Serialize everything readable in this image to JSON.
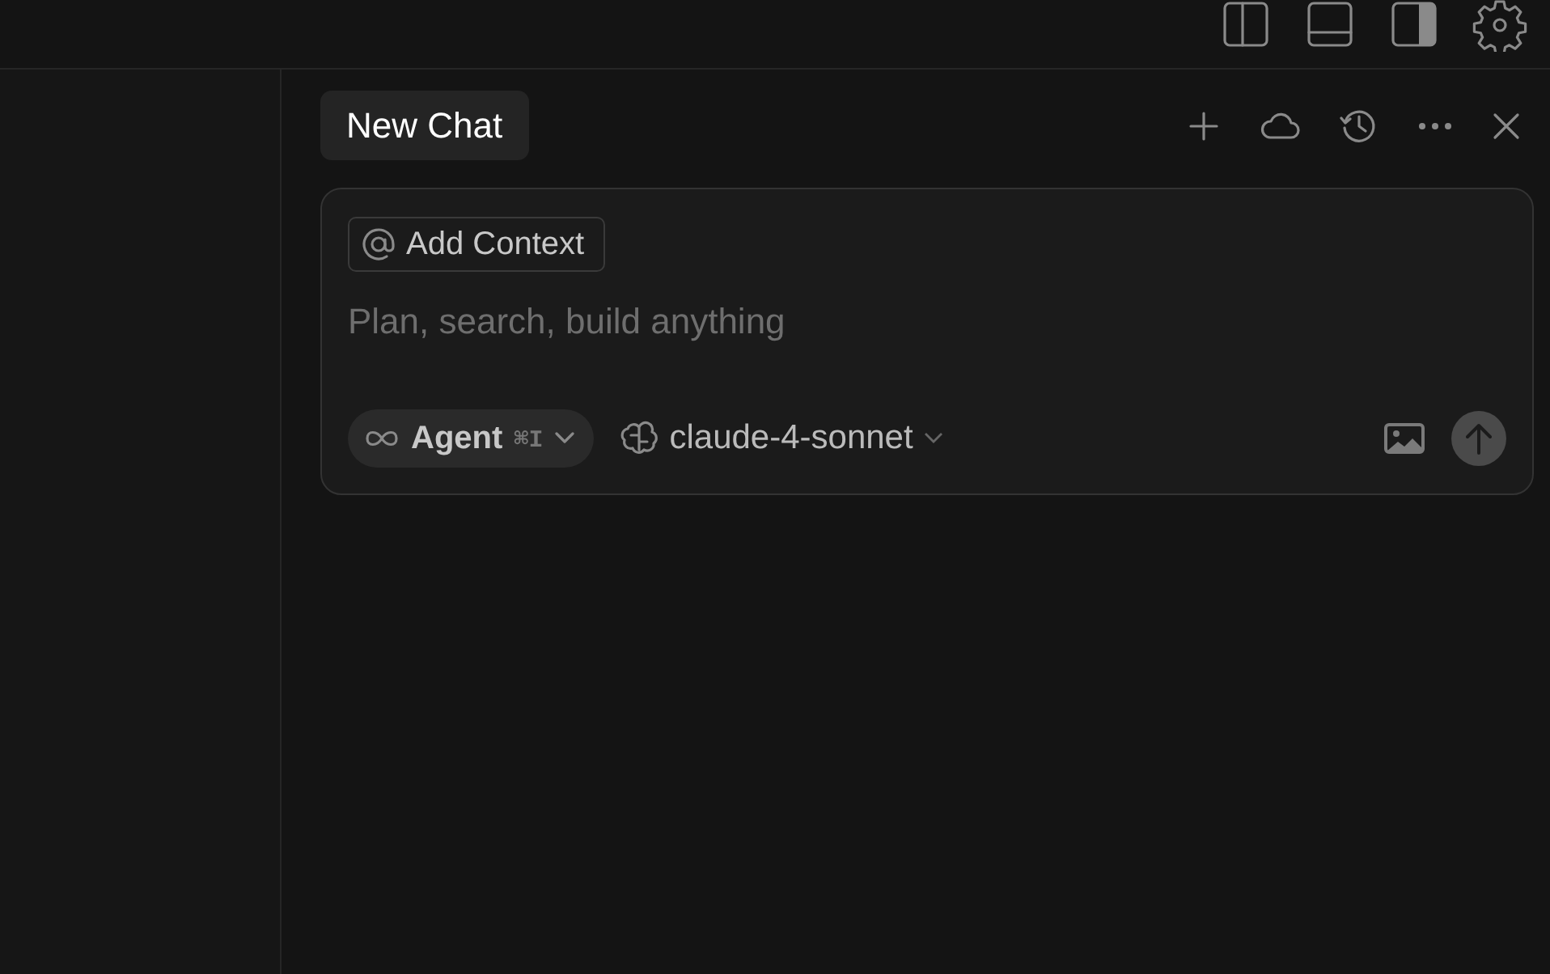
{
  "chat": {
    "tab": {
      "label": "New Chat",
      "selected": true
    },
    "context_button": "Add Context",
    "input": {
      "placeholder": "Plan, search, build anything"
    },
    "mode": {
      "label": "Agent",
      "shortcut": "⌘I"
    },
    "model": {
      "label": "claude-4-sonnet"
    }
  }
}
